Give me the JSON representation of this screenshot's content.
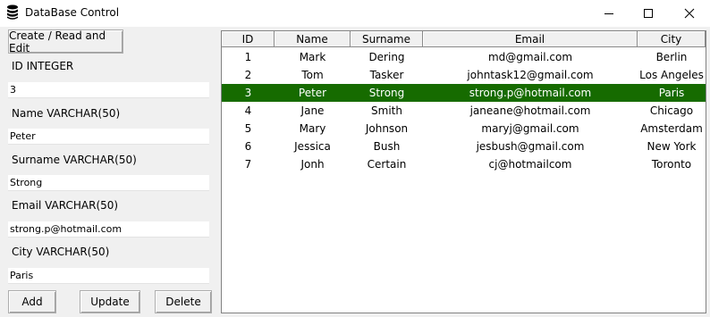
{
  "window": {
    "title": "DataBase Control",
    "app_icon": "database-icon"
  },
  "form": {
    "create_button": "Create / Read and Edit",
    "fields": [
      {
        "label": "ID INTEGER",
        "value": "3"
      },
      {
        "label": "Name VARCHAR(50)",
        "value": "Peter"
      },
      {
        "label": "Surname VARCHAR(50)",
        "value": "Strong"
      },
      {
        "label": "Email VARCHAR(50)",
        "value": "strong.p@hotmail.com"
      },
      {
        "label": "City VARCHAR(50)",
        "value": "Paris"
      }
    ],
    "buttons": {
      "add": "Add",
      "update": "Update",
      "delete": "Delete"
    }
  },
  "table": {
    "columns": [
      "ID",
      "Name",
      "Surname",
      "Email",
      "City"
    ],
    "selected_row": 2,
    "selected_color": "#166b00",
    "rows": [
      [
        "1",
        "Mark",
        "Dering",
        "md@gmail.com",
        "Berlin"
      ],
      [
        "2",
        "Tom",
        "Tasker",
        "johntask12@gmail.com",
        "Los Angeles"
      ],
      [
        "3",
        "Peter",
        "Strong",
        "strong.p@hotmail.com",
        "Paris"
      ],
      [
        "4",
        "Jane",
        "Smith",
        "janeane@hotmail.com",
        "Chicago"
      ],
      [
        "5",
        "Mary",
        "Johnson",
        "maryj@gmail.com",
        "Amsterdam"
      ],
      [
        "6",
        "Jessica",
        "Bush",
        "jesbush@gmail.com",
        "New York"
      ],
      [
        "7",
        "Jonh",
        "Certain",
        "cj@hotmailcom",
        "Toronto"
      ]
    ]
  }
}
